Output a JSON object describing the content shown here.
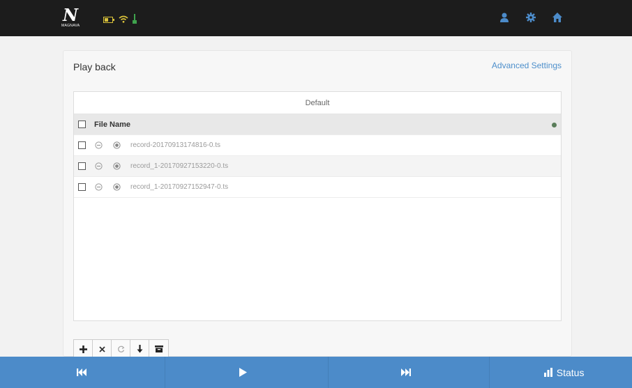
{
  "header": {
    "brand_mark": "N",
    "brand_text": "MAGNAVA"
  },
  "panel": {
    "title": "Play back",
    "advanced_link": "Advanced Settings",
    "folder": "Default",
    "column_header": "File Name",
    "files": [
      {
        "name": "record-20170913174816-0.ts"
      },
      {
        "name": "record_1-20170927153220-0.ts"
      },
      {
        "name": "record_1-20170927152947-0.ts"
      }
    ]
  },
  "bottombar": {
    "status_label": "Status"
  },
  "colors": {
    "topbar": "#1c1c1c",
    "accent_blue": "#4c8bc9",
    "battery_yellow": "#d9c23a",
    "signal_green": "#3fa34d"
  }
}
